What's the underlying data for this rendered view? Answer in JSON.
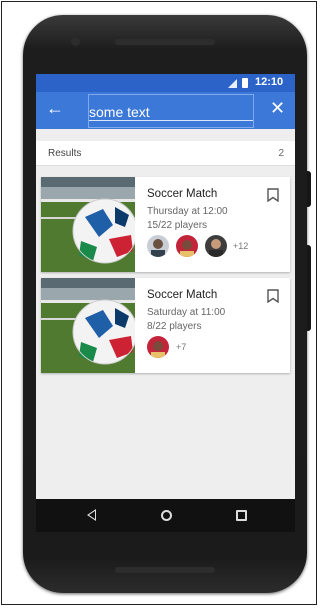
{
  "statusbar": {
    "time": "12:10"
  },
  "appbar": {
    "back_icon": "arrow-left-icon",
    "search_value": "some text",
    "close_icon": "close-icon"
  },
  "results": {
    "label": "Results",
    "count": "2"
  },
  "cards": [
    {
      "title": "Soccer Match",
      "time": "Thursday at 12:00",
      "players": "15/22 players",
      "more": "+12"
    },
    {
      "title": "Soccer Match",
      "time": "Saturday at 11:00",
      "players": "8/22 players",
      "more": "+7"
    }
  ],
  "colors": {
    "status_bar": "#2c63c9",
    "app_bar": "#3b78d8",
    "background": "#eeeeee"
  }
}
